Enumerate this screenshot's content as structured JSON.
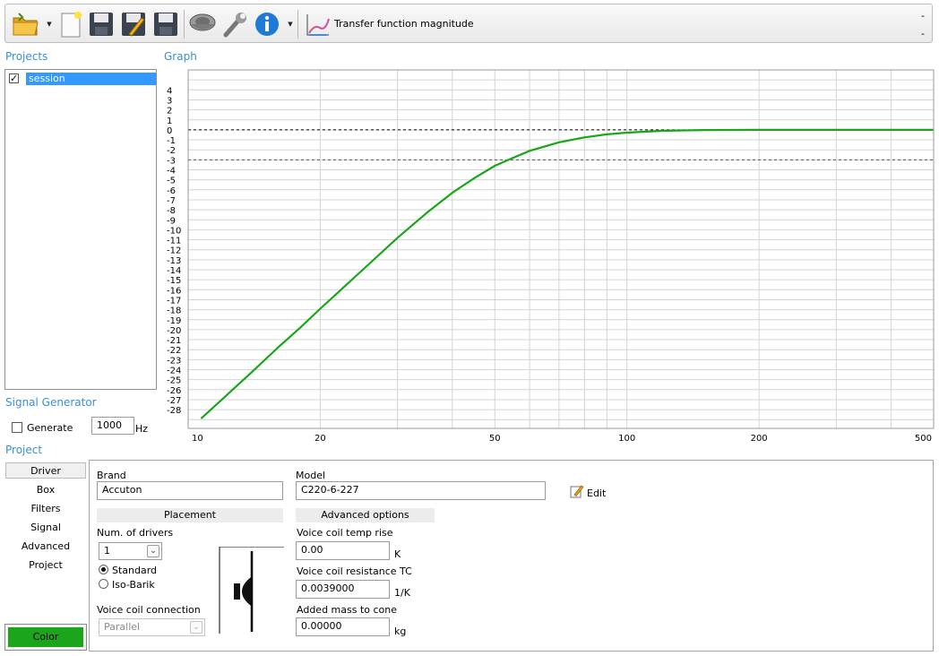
{
  "toolbar": {
    "items": [
      "open-folder-icon",
      "new-document-icon",
      "save-icon",
      "save-edit-icon",
      "save-as-icon",
      "speaker-icon",
      "wrench-icon",
      "info-icon"
    ],
    "view_label": "Transfer function magnitude",
    "dash_top": "-",
    "dash_bottom": "-"
  },
  "projects": {
    "title": "Projects",
    "session_label": "session",
    "session_checked": true
  },
  "graph": {
    "title": "Graph"
  },
  "chart_data": {
    "type": "line",
    "xscale": "log",
    "xlim": [
      10,
      500
    ],
    "ylim": [
      -29,
      6
    ],
    "x_ticks": [
      10,
      20,
      50,
      100,
      200,
      500
    ],
    "y_ticks": [
      4,
      3,
      2,
      1,
      0,
      -1,
      -2,
      -3,
      -4,
      -5,
      -6,
      -7,
      -8,
      -9,
      -10,
      -11,
      -12,
      -13,
      -14,
      -15,
      -16,
      -17,
      -18,
      -19,
      -20,
      -21,
      -22,
      -23,
      -24,
      -25,
      -26,
      -27,
      -28
    ],
    "reference_lines": [
      0,
      -3
    ],
    "series": [
      {
        "color": "#1aa51a",
        "x": [
          10.7,
          12,
          14,
          16,
          18,
          20,
          25,
          30,
          35,
          40,
          45,
          50,
          55,
          60,
          70,
          80,
          90,
          100,
          120,
          150,
          200,
          300,
          500
        ],
        "y": [
          -28.9,
          -26.9,
          -24.2,
          -21.8,
          -19.8,
          -17.9,
          -14.0,
          -10.8,
          -8.3,
          -6.3,
          -4.8,
          -3.6,
          -2.8,
          -2.1,
          -1.25,
          -0.75,
          -0.45,
          -0.28,
          -0.1,
          -0.02,
          0,
          0,
          0
        ]
      }
    ]
  },
  "signal_generator": {
    "title": "Signal Generator",
    "generate_label": "Generate",
    "frequency_value": "1000",
    "frequency_unit": "Hz"
  },
  "project": {
    "title": "Project",
    "tabs": [
      "Driver",
      "Box",
      "Filters",
      "Signal",
      "Advanced",
      "Project"
    ],
    "active_tab": "Driver",
    "color_button": "Color",
    "color_value": "#1aa51a"
  },
  "driver": {
    "brand_label": "Brand",
    "brand_value": "Accuton",
    "model_label": "Model",
    "model_value": "C220-6-227",
    "edit_label": "Edit",
    "placement_header": "Placement",
    "num_drivers_label": "Num. of drivers",
    "num_drivers_value": "1",
    "standard_label": "Standard",
    "isobarik_label": "Iso-Barik",
    "placement_mode": "Standard",
    "vc_connection_label": "Voice coil connection",
    "vc_connection_value": "Parallel",
    "advanced_header": "Advanced options",
    "vc_temp_label": "Voice coil temp rise",
    "vc_temp_value": "0.00",
    "vc_temp_unit": "K",
    "vc_tc_label": "Voice coil resistance TC",
    "vc_tc_value": "0.0039000",
    "vc_tc_unit": "1/K",
    "added_mass_label": "Added mass to cone",
    "added_mass_value": "0.00000",
    "added_mass_unit": "kg"
  }
}
